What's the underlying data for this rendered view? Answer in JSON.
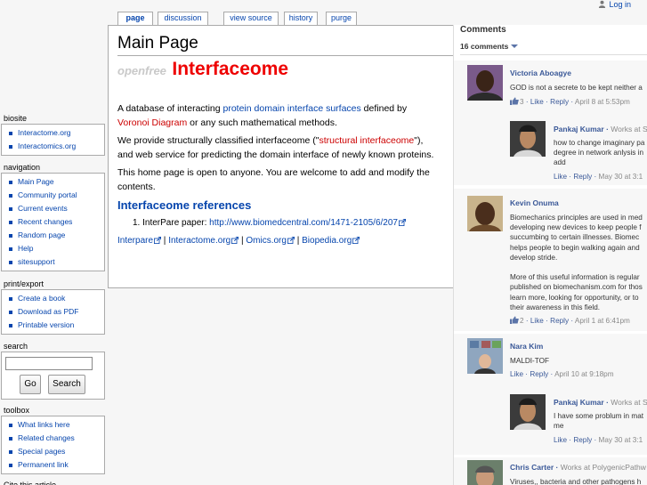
{
  "personal": {
    "login": "Log in"
  },
  "tabs": [
    {
      "label": "page"
    },
    {
      "label": "discussion"
    },
    {
      "label": "view source"
    },
    {
      "label": "history"
    },
    {
      "label": "purge"
    }
  ],
  "content": {
    "title": "Main Page",
    "tagline_prefix": "openfree",
    "tagline_brand": "Interfaceome",
    "p1": {
      "t1": "A database of  interacting ",
      "link1": "protein domain",
      "t2": " ",
      "link2": "interface surfaces",
      "t3": " defined by ",
      "link3": "Voronoi Diagram",
      "t4": " or any such mathematical methods."
    },
    "p2": {
      "t1": "We provide structurally classified interfaceome (\"",
      "link1": "structural interfaceome",
      "t2": "\"), and web service for predicting the domain interface of newly known proteins."
    },
    "p3": "This home page is open to anyone. You are welcome to add and modify the contents.",
    "section_heading": "Interfaceome references",
    "ref1_label": "1.   InterPare paper:  ",
    "ref1_link": "http://www.biomedcentral.com/1471-2105/6/207",
    "links": [
      "Interpare",
      "Interactome.org",
      "Omics.org",
      "Biopedia.org"
    ],
    "sep": " | "
  },
  "sidebar": {
    "biosite": {
      "title": "biosite",
      "items": [
        "Interactome.org",
        "Interactomics.org"
      ]
    },
    "navigation": {
      "title": "navigation",
      "items": [
        "Main Page",
        "Community portal",
        "Current events",
        "Recent changes",
        "Random page",
        "Help",
        "sitesupport"
      ]
    },
    "print": {
      "title": "print/export",
      "items": [
        "Create a book",
        "Download as PDF",
        "Printable version"
      ]
    },
    "search": {
      "title": "search",
      "go": "Go",
      "search": "Search",
      "value": ""
    },
    "toolbox": {
      "title": "toolbox",
      "items": [
        "What links here",
        "Related changes",
        "Special pages",
        "Permanent link"
      ]
    },
    "more": "Cite this article"
  },
  "comments": {
    "heading": "Comments",
    "count": "16 comments",
    "list": [
      {
        "name": "Victoria Aboagye",
        "works": "",
        "lines": [
          "GOD is not a secrete to be kept neither a"
        ],
        "likes": "3",
        "meta_like": "Like",
        "meta_reply": "Reply",
        "time": "April 8 at 5:53pm"
      },
      {
        "name": "Pankaj Kumar",
        "works": "Works at S",
        "lines": [
          "how to change imaginary pa",
          "degree in network anlysis in",
          "add"
        ],
        "likes": "",
        "meta_like": "Like",
        "meta_reply": "Reply",
        "time": "May 30 at 3:1"
      },
      {
        "name": "Kevin Onuma",
        "works": "",
        "lines": [
          "Biomechanics principles are used in med",
          "developing new devices to keep people f",
          "succumbing to certain illnesses. Biomec",
          "helps people to begin walking again and",
          "develop stride.",
          "",
          "More of this useful information is regular",
          "published on biomechanism.com for thos",
          "learn more, looking for opportunity, or to",
          "their awareness in this field."
        ],
        "likes": "2",
        "meta_like": "Like",
        "meta_reply": "Reply",
        "time": "April 1 at 6:41pm"
      },
      {
        "name": "Nara Kim",
        "works": "",
        "lines": [
          "MALDI-TOF"
        ],
        "likes": "",
        "meta_like": "Like",
        "meta_reply": "Reply",
        "time": "April 10 at 9:18pm"
      },
      {
        "name": "Pankaj Kumar",
        "works": "Works at S",
        "lines": [
          "I have some problum in mat",
          "me"
        ],
        "likes": "",
        "meta_like": "Like",
        "meta_reply": "Reply",
        "time": "May 30 at 3:1"
      },
      {
        "name": "Chris Carter",
        "works": "Works at PolygenicPathw",
        "lines": [
          "Viruses,, bacteria and other pathogens h"
        ],
        "likes": "",
        "meta_like": "",
        "meta_reply": "",
        "time": ""
      }
    ]
  },
  "colors": {
    "brand_red": "#ee0000",
    "link_blue": "#0645ad",
    "fb_blue": "#3b5998"
  }
}
